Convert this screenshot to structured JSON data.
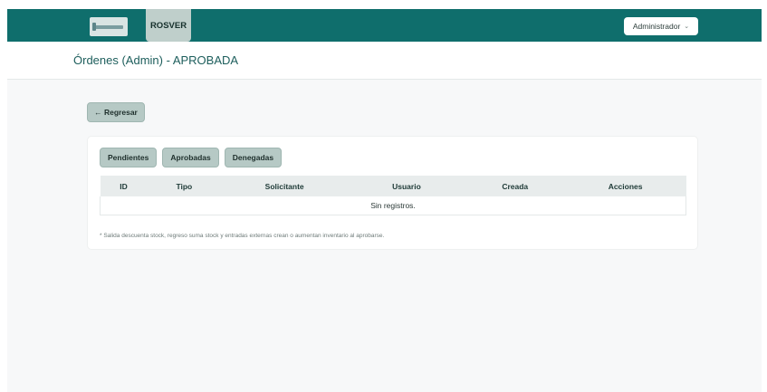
{
  "topbar": {
    "brand_label": "ROSVER",
    "user_menu_label": "Administrador",
    "colors": {
      "bar": "#0f6e6c",
      "accent": "#bfcfcb"
    }
  },
  "header": {
    "title": "Órdenes (Admin) - APROBADA"
  },
  "back_button": {
    "label": "← Regresar"
  },
  "tabs": [
    {
      "label": "Pendientes"
    },
    {
      "label": "Aprobadas"
    },
    {
      "label": "Denegadas"
    }
  ],
  "table": {
    "columns": [
      "ID",
      "Tipo",
      "Solicitante",
      "Usuario",
      "Creada",
      "Acciones"
    ],
    "empty_message": "Sin registros."
  },
  "note": "* Salida descuenta stock, regreso suma stock y entradas externas crean o aumentan inventario al aprobarse."
}
